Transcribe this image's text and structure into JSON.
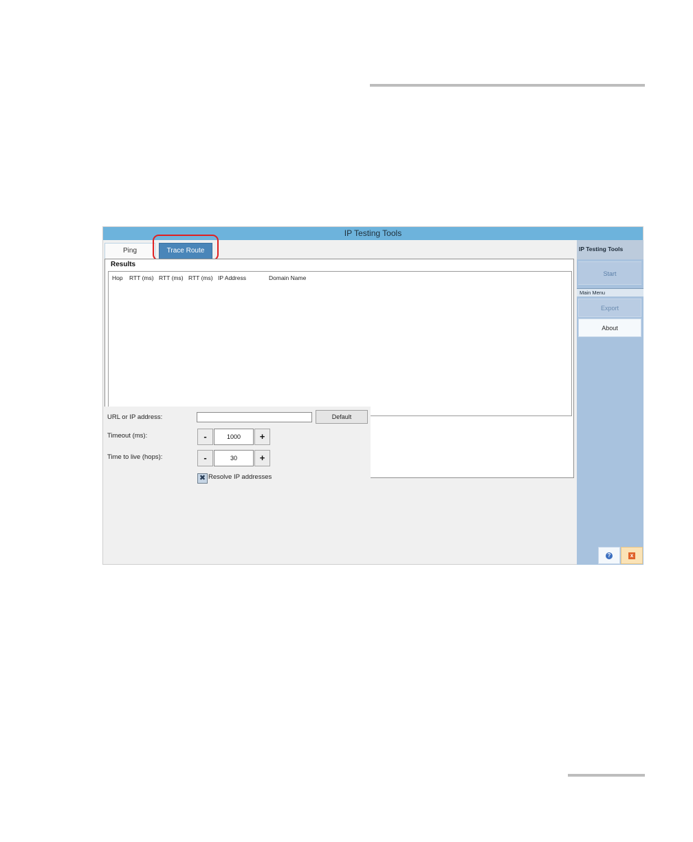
{
  "window": {
    "title": "IP Testing Tools"
  },
  "tabs": {
    "ping": "Ping",
    "trace_route": "Trace Route"
  },
  "results": {
    "title": "Results",
    "columns": [
      "Hop",
      "RTT (ms)",
      "RTT (ms)",
      "RTT (ms)",
      "IP Address",
      "Domain Name"
    ]
  },
  "settings": {
    "url_label": "URL or IP address:",
    "url_value": "",
    "default_button": "Default",
    "timeout_label": "Timeout (ms):",
    "timeout_value": "1000",
    "ttl_label": "Time to live (hops):",
    "ttl_value": "30",
    "decrement": "-",
    "increment": "+",
    "resolve_label": "Resolve IP addresses",
    "resolve_checked": true,
    "check_glyph": "✖"
  },
  "sidebar": {
    "header": "IP Testing Tools",
    "start": "Start",
    "section": "Main Menu",
    "export": "Export",
    "about": "About",
    "help_icon": "help-icon",
    "close_icon": "close-icon",
    "help_glyph": "?",
    "close_glyph": "x"
  },
  "colors": {
    "titlebar": "#6db3dc",
    "active_tab": "#4a86b9",
    "sidebar": "#a8c2de",
    "highlight": "#e02020"
  }
}
